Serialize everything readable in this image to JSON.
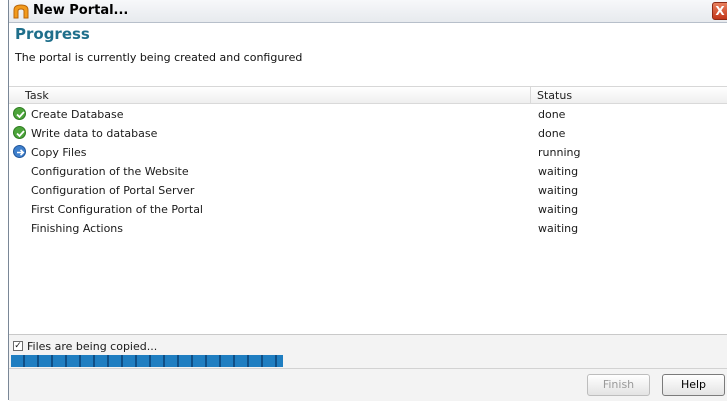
{
  "window": {
    "title": "New Portal...",
    "close_label": "X"
  },
  "header": {
    "title": "Progress",
    "subtitle": "The portal is currently being created and configured"
  },
  "table": {
    "columns": [
      "Task",
      "Status"
    ],
    "rows": [
      {
        "task": "Create Database",
        "status": "done",
        "icon": "check-icon"
      },
      {
        "task": "Write data to database",
        "status": "done",
        "icon": "check-icon"
      },
      {
        "task": "Copy Files",
        "status": "running",
        "icon": "arrow-right-icon"
      },
      {
        "task": "Configuration of the Website",
        "status": "waiting",
        "icon": ""
      },
      {
        "task": "Configuration of Portal Server",
        "status": "waiting",
        "icon": ""
      },
      {
        "task": "First Configuration of the Portal",
        "status": "waiting",
        "icon": ""
      },
      {
        "task": "Finishing Actions",
        "status": "waiting",
        "icon": ""
      }
    ]
  },
  "status_bar": {
    "message": "Files are being copied..."
  },
  "buttons": {
    "finish": "Finish",
    "help": "Help"
  },
  "colors": {
    "accent": "#1f6f8b",
    "done_green": "#4ca43a",
    "running_blue": "#3e7fcc",
    "progress_blue": "#1f7ec1"
  }
}
